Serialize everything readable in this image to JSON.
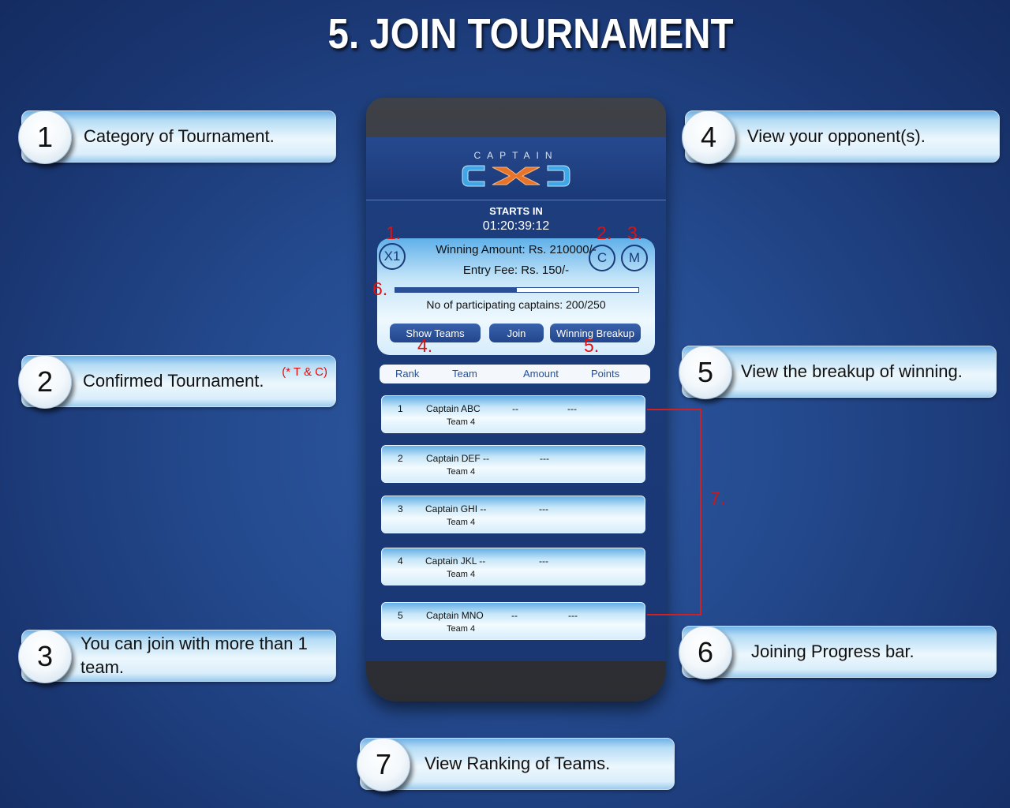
{
  "page_title": "5. JOIN TOURNAMENT",
  "callouts": [
    {
      "number": "1",
      "text": "Category of Tournament."
    },
    {
      "number": "2",
      "text": "Confirmed Tournament.",
      "note": "(* T & C)"
    },
    {
      "number": "3",
      "text": "You can join with more than 1 team."
    },
    {
      "number": "4",
      "text": "View your opponent(s)."
    },
    {
      "number": "5",
      "text": "View the breakup of winning."
    },
    {
      "number": "6",
      "text": "Joining Progress bar."
    },
    {
      "number": "7",
      "text": "View Ranking of Teams."
    }
  ],
  "app": {
    "logo_top": "CAPTAIN",
    "starts_label": "STARTS IN",
    "countdown": "01:20:39:12",
    "card": {
      "category_badge": "X1",
      "confirmed_badge": "C",
      "multi_badge": "M",
      "winning_amount": "Winning Amount: Rs. 210000/-",
      "entry_fee": "Entry Fee: Rs. 150/-",
      "progress_fraction": 0.5,
      "participants": "No of participating captains: 200/250",
      "buttons": {
        "show_teams": "Show Teams",
        "join": "Join",
        "winning_breakup": "Winning Breakup"
      }
    },
    "markers": {
      "m1": "1.",
      "m2": "2.",
      "m3": "3.",
      "m4": "4.",
      "m5": "5.",
      "m6": "6.",
      "m7": "7."
    },
    "table": {
      "headers": {
        "rank": "Rank",
        "team": "Team",
        "amount": "Amount",
        "points": "Points"
      },
      "rows": [
        {
          "rank": "1",
          "team": "Captain ABC",
          "sub": "Team 4",
          "amount": "--",
          "points": "---"
        },
        {
          "rank": "2",
          "team": "Captain DEF --",
          "sub": "Team 4",
          "amount": "",
          "points": "---"
        },
        {
          "rank": "3",
          "team": "Captain GHI --",
          "sub": "Team 4",
          "amount": "",
          "points": "---"
        },
        {
          "rank": "4",
          "team": "Captain JKL --",
          "sub": "Team 4",
          "amount": "",
          "points": "---"
        },
        {
          "rank": "5",
          "team": "Captain MNO",
          "sub": "Team 4",
          "amount": "--",
          "points": "---"
        }
      ]
    }
  },
  "colors": {
    "background": "#244a8e",
    "accent_red": "#e01010",
    "button_blue": "#22468d"
  }
}
